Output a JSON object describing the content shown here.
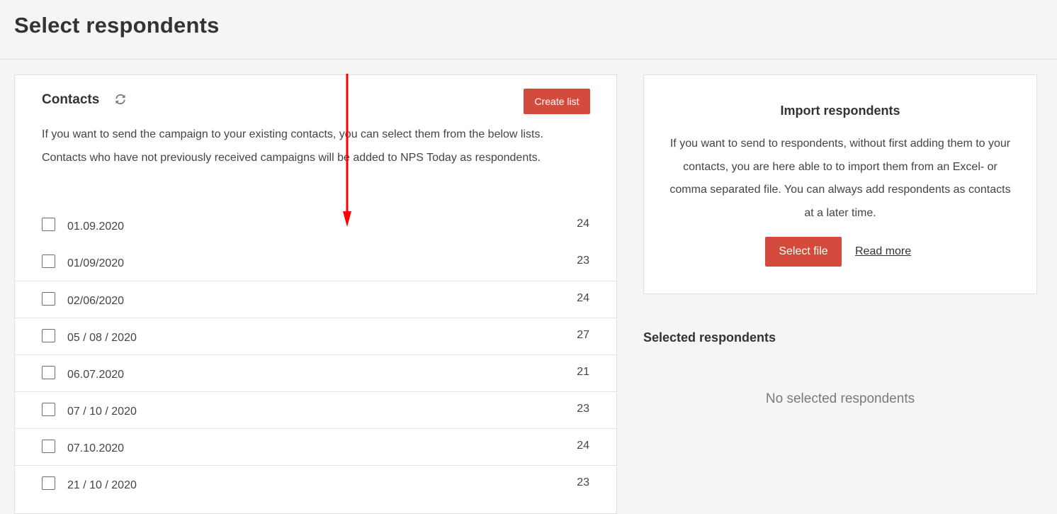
{
  "page": {
    "title": "Select respondents"
  },
  "contacts": {
    "title": "Contacts",
    "refresh_icon": "refresh-icon",
    "create_list_label": "Create list",
    "description": "If you want to send the campaign to your existing contacts, you can select them from the below lists. Contacts who have not previously received campaigns will be added to NPS Today as respondents.",
    "lists": [
      {
        "name": "01.09.2020",
        "count": "24"
      },
      {
        "name": "01/09/2020",
        "count": "23"
      },
      {
        "name": "02/06/2020",
        "count": "24"
      },
      {
        "name": "05 / 08 / 2020",
        "count": "27"
      },
      {
        "name": "06.07.2020",
        "count": "21"
      },
      {
        "name": "07 / 10 / 2020",
        "count": "23"
      },
      {
        "name": "07.10.2020",
        "count": "24"
      },
      {
        "name": "21 / 10 / 2020",
        "count": "23"
      }
    ]
  },
  "import": {
    "title": "Import respondents",
    "description": "If you want to send to respondents, without first adding them to your contacts, you are here able to to import them from an Excel- or comma separated file. You can always add respondents as contacts at a later time.",
    "select_file_label": "Select file",
    "read_more_label": "Read more"
  },
  "selected": {
    "title": "Selected respondents",
    "empty_text": "No selected respondents"
  },
  "colors": {
    "accent": "#d44b3d",
    "annotation": "#ff0000",
    "background": "#f5f5f5"
  }
}
